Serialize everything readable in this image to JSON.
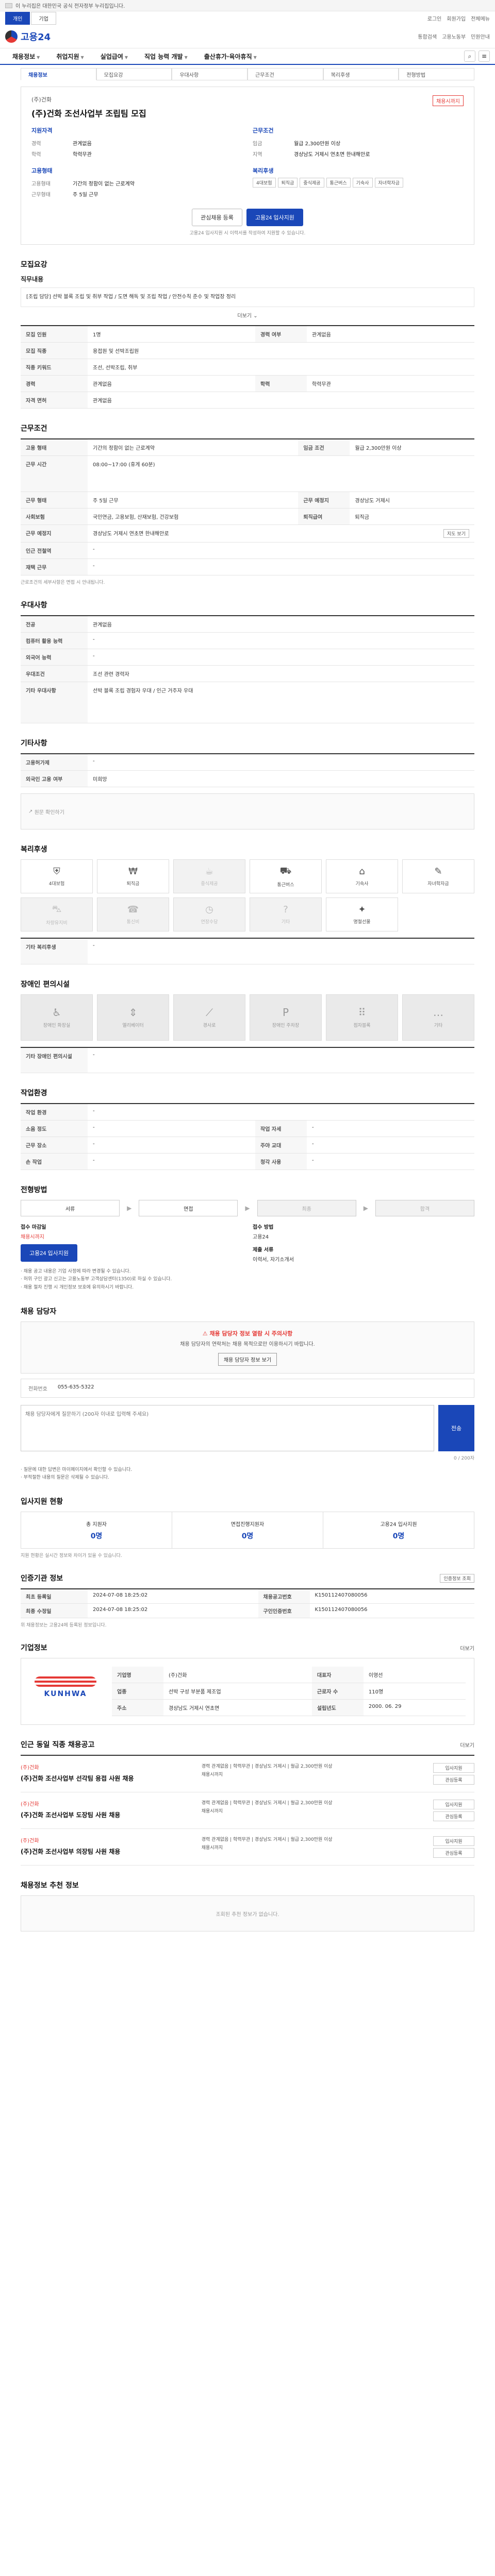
{
  "top": {
    "gov_notice": "이 누리집은 대한민국 공식 전자정부 누리집입니다."
  },
  "util": {
    "tabs": [
      "개인",
      "기업"
    ],
    "links": [
      "로그인",
      "회원가입",
      "전체메뉴"
    ]
  },
  "header": {
    "logo": "고용24",
    "right_links": [
      "통합검색",
      "고용노동부",
      "민원안내"
    ]
  },
  "gnb": {
    "items": [
      "채용정보",
      "취업지원",
      "실업급여",
      "직업 능력 개발",
      "출산휴가·육아휴직"
    ]
  },
  "subtabs": [
    "채용정보",
    "모집요강",
    "우대사항",
    "근무조건",
    "복리후생",
    "전형방법"
  ],
  "company": {
    "name": "(주)건화",
    "title": "(주)건화 조선사업부 조립팀 모집",
    "badge": "채용시까지",
    "left_title": "지원자격",
    "left_rows": [
      {
        "k": "경력",
        "v": "관계없음"
      },
      {
        "k": "학력",
        "v": "학력무관"
      }
    ],
    "right_title": "근무조건",
    "right_rows": [
      {
        "k": "임금",
        "v": "월급 2,300만원 이상"
      },
      {
        "k": "지역",
        "v": "경상남도 거제시 연초면 한내해안로"
      }
    ],
    "left_title2": "고용형태",
    "left_rows2": [
      {
        "k": "고용형태",
        "v": "기간의 정함이 없는 근로계약"
      },
      {
        "k": "근무형태",
        "v": "주 5일 근무"
      }
    ],
    "right_title2": "복리후생",
    "chips": [
      "4대보험",
      "퇴직금",
      "중식제공",
      "통근버스",
      "기숙사",
      "자녀학자금"
    ],
    "actions": [
      "관심채용 등록",
      "고용24 입사지원"
    ],
    "note": "고용24 입사지원 시 이력서를 작성하여 지원할 수 있습니다."
  },
  "recruit": {
    "title": "모집요강",
    "duty_label": "직무내용",
    "duty_text": "[조립 담당] 선박 블록 조립 및 취부 작업 / 도면 해독 및 조립 작업 / 안전수칙 준수 및 작업장 정리",
    "more": "더보기",
    "rows": [
      {
        "k": "모집 인원",
        "v": "1명",
        "k2": "경력 여부",
        "v2": "관계없음"
      },
      {
        "k": "모집 직종",
        "v": "용접원 및 선박조립원",
        "k2": "",
        "v2": ""
      },
      {
        "k": "직종 키워드",
        "v": "조선, 선박조립, 취부",
        "k2": "",
        "v2": ""
      },
      {
        "k": "경력",
        "v": "관계없음",
        "k2": "학력",
        "v2": "학력무관"
      },
      {
        "k": "자격 면허",
        "v": "관계없음",
        "k2": "",
        "v2": ""
      }
    ]
  },
  "work": {
    "title": "근무조건",
    "rows": [
      {
        "k": "고용 형태",
        "v": "기간의 정함이 없는 근로계약",
        "k2": "임금 조건",
        "v2": "월급 2,300만원 이상"
      },
      {
        "k": "근무 시간",
        "v": "08:00~17:00 (휴게 60분)",
        "k2": "",
        "v2": ""
      },
      {
        "k": "근무 형태",
        "v": "주 5일 근무",
        "k2": "근무 예정지",
        "v2": "경상남도 거제시"
      },
      {
        "k": "사회보험",
        "v": "국민연금, 고용보험, 산재보험, 건강보험",
        "k2": "퇴직급여",
        "v2": "퇴직금"
      },
      {
        "k": "근무 예정지",
        "v": "경상남도 거제시 연초면 한내해안로",
        "k2": "",
        "v2": ""
      },
      {
        "k": "인근 전철역",
        "v": "-",
        "k2": "",
        "v2": ""
      },
      {
        "k": "재택 근무",
        "v": "-",
        "k2": "",
        "v2": ""
      }
    ],
    "map_btn": "지도 보기",
    "footnote": "근로조건의 세부사항은 면접 시 안내됩니다."
  },
  "prefer": {
    "title": "우대사항",
    "rows": [
      {
        "k": "전공",
        "v": "관계없음"
      },
      {
        "k": "컴퓨터 활용 능력",
        "v": "-"
      },
      {
        "k": "외국어 능력",
        "v": "-"
      },
      {
        "k": "우대조건",
        "v": "조선 관련 경력자"
      },
      {
        "k": "기타 우대사항",
        "v": "선박 블록 조립 경험자 우대 / 인근 거주자 우대"
      }
    ]
  },
  "other": {
    "title": "기타사항",
    "rows": [
      {
        "k": "고용허가제",
        "v": "-"
      },
      {
        "k": "외국인 고용 여부",
        "v": "미희망"
      }
    ],
    "link": "원문 확인하기"
  },
  "welfare": {
    "title": "복리후생",
    "items": [
      {
        "icon": "shield-icon",
        "label": "4대보험",
        "on": true
      },
      {
        "icon": "money-icon",
        "label": "퇴직금",
        "on": true
      },
      {
        "icon": "meal-icon",
        "label": "중식제공",
        "on": false
      },
      {
        "icon": "bus-icon",
        "label": "통근버스",
        "on": true
      },
      {
        "icon": "home-icon",
        "label": "기숙사",
        "on": true
      },
      {
        "icon": "book-icon",
        "label": "자녀학자금",
        "on": true
      },
      {
        "icon": "car-icon",
        "label": "차량유지비",
        "on": false
      },
      {
        "icon": "phone-icon",
        "label": "통신비",
        "on": false
      },
      {
        "icon": "clock-icon",
        "label": "연장수당",
        "on": false
      },
      {
        "icon": "help-icon",
        "label": "기타",
        "on": false
      },
      {
        "icon": "gift-icon",
        "label": "명절선물",
        "on": true
      }
    ],
    "extra_label": "기타 복리후생",
    "extra_value": "-"
  },
  "disability": {
    "title": "장애인 편의시설",
    "items": [
      "장애인 화장실",
      "엘리베이터",
      "경사로",
      "장애인 주차장",
      "점자블록",
      "기타"
    ],
    "extra_label": "기타 장애인 편의시설",
    "extra_value": "-"
  },
  "env": {
    "title": "작업환경",
    "rows": [
      {
        "k": "작업 환경",
        "v": "-",
        "k2": "",
        "v2": ""
      },
      {
        "k": "소음 정도",
        "v": "-",
        "k2": "작업 자세",
        "v2": "-"
      },
      {
        "k": "근무 장소",
        "v": "-",
        "k2": "주야 교대",
        "v2": "-"
      },
      {
        "k": "손 작업",
        "v": "-",
        "k2": "청각 사용",
        "v2": "-"
      }
    ]
  },
  "process": {
    "title": "전형방법",
    "steps": [
      {
        "label": "서류",
        "on": true
      },
      {
        "label": "면접",
        "on": true
      },
      {
        "label": "최종",
        "on": false
      },
      {
        "label": "합격",
        "on": false
      }
    ],
    "apply_label": "접수 마감일",
    "apply_value": "채용시까지",
    "method_label": "접수 방법",
    "method_value": "고용24",
    "apply_btn": "고용24 입사지원",
    "docs_label": "제출 서류",
    "docs_value": "이력서, 자기소개서",
    "bullets": [
      "· 채용 공고 내용은 기업 사정에 따라 변경될 수 있습니다.",
      "· 허위 구인 광고 신고는 고용노동부 고객상담센터(1350)로 하실 수 있습니다.",
      "· 채용 절차 진행 시 개인정보 보호에 유의하시기 바랍니다."
    ]
  },
  "contact": {
    "title": "채용 담당자",
    "warn_title": "채용 담당자 정보 열람 시 주의사항",
    "warn_desc": "채용 담당자의 연락처는 채용 목적으로만 이용하시기 바랍니다.",
    "warn_btn": "채용 담당자 정보 보기",
    "phone_label": "전화번호",
    "phone_value": "055-635-5322",
    "qna_placeholder": "채용 담당자에게 질문하기 (200자 이내로 입력해 주세요)",
    "qna_btn": "전송",
    "counter": "0 / 200자",
    "notes": [
      "· 질문에 대한 답변은 마이페이지에서 확인할 수 있습니다.",
      "· 부적절한 내용의 질문은 삭제될 수 있습니다."
    ]
  },
  "stats": {
    "title": "입사지원 현황",
    "items": [
      {
        "label": "총 지원자",
        "value": "0명"
      },
      {
        "label": "면접진행지원자",
        "value": "0명"
      },
      {
        "label": "고용24 입사지원",
        "value": "0명"
      }
    ],
    "note": "지원 현황은 실시간 정보와 차이가 있을 수 있습니다."
  },
  "info": {
    "title": "인증기관 정보",
    "btn": "인증정보 조회",
    "rows": [
      {
        "k": "최초 등록일",
        "v": "2024-07-08 18:25:02",
        "k2": "채용공고번호",
        "v2": "K150112407080056"
      },
      {
        "k": "최종 수정일",
        "v": "2024-07-08 18:25:02",
        "k2": "구인인증번호",
        "v2": "K150112407080056"
      }
    ],
    "footnote": "위 채용정보는 고용24에 등록된 정보입니다."
  },
  "company_info": {
    "title": "기업정보",
    "more": "더보기",
    "logo_name": "KUNHWA",
    "rows": [
      {
        "k": "기업명",
        "v": "(주)건화",
        "k2": "대표자",
        "v2": "이영선"
      },
      {
        "k": "업종",
        "v": "선박 구성 부분품 제조업",
        "k2": "근로자 수",
        "v2": "110명"
      },
      {
        "k": "주소",
        "v": "경상남도 거제시 연초면",
        "k2": "설립년도",
        "v2": "2000. 06. 29"
      }
    ]
  },
  "other_jobs": {
    "title": "인근 동일 직종 채용공고",
    "more": "더보기",
    "items": [
      {
        "company": "(주)건화",
        "title": "(주)건화 조선사업부 선각팀 용접 사원 채용",
        "meta": "경력 관계없음 | 학력무관 | 경상남도 거제시 | 월급 2,300만원 이상",
        "deadline": "채용시까지",
        "buttons": [
          "입사지원",
          "관심등록"
        ]
      },
      {
        "company": "(주)건화",
        "title": "(주)건화 조선사업부 도장팀 사원 채용",
        "meta": "경력 관계없음 | 학력무관 | 경상남도 거제시 | 월급 2,300만원 이상",
        "deadline": "채용시까지",
        "buttons": [
          "입사지원",
          "관심등록"
        ]
      },
      {
        "company": "(주)건화",
        "title": "(주)건화 조선사업부 의장팀 사원 채용",
        "meta": "경력 관계없음 | 학력무관 | 경상남도 거제시 | 월급 2,300만원 이상",
        "deadline": "채용시까지",
        "buttons": [
          "입사지원",
          "관심등록"
        ]
      }
    ]
  },
  "recommend": {
    "title": "채용정보 추천 정보",
    "empty": "조회된 추천 정보가 없습니다."
  }
}
